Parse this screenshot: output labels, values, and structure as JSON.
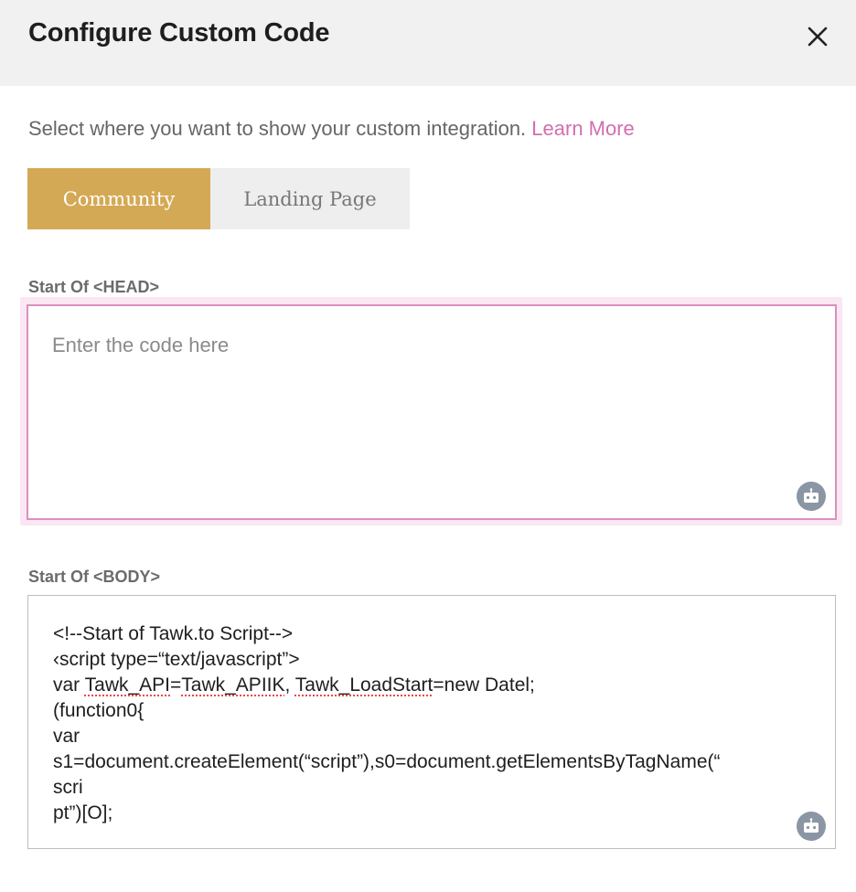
{
  "dialog": {
    "title": "Configure Custom Code",
    "close_icon": "close-icon"
  },
  "intro": {
    "text": "Select where you want to show your custom integration. ",
    "link": "Learn More"
  },
  "tabs": [
    {
      "label": "Community",
      "active": true
    },
    {
      "label": "Landing Page",
      "active": false
    }
  ],
  "head_section": {
    "label": "Start Of <HEAD>",
    "placeholder": "Enter the code here",
    "value": "",
    "assist_icon": "robot-icon"
  },
  "body_section": {
    "label": "Start Of <BODY>",
    "assist_icon": "robot-icon",
    "code_lines": [
      [
        "<!--Start of Tawk.to Script-->"
      ],
      [
        "‹script type=“text/javascript”>"
      ],
      [
        "var ",
        {
          "t": "Tawk_API",
          "u": true
        },
        "=",
        {
          "t": "Tawk_APIIK",
          "u": true
        },
        ", ",
        {
          "t": "Tawk_LoadStart",
          "u": true
        },
        "=new Datel;"
      ],
      [
        "(function0{"
      ],
      [
        "var"
      ],
      [
        "s1=document.createElement(“script”),s0=document.getElementsByTagName(“"
      ],
      [
        "scri"
      ],
      [
        "pt”)[O];"
      ]
    ]
  },
  "colors": {
    "accent": "#d4a955",
    "link": "#d16fae",
    "focus_border": "#d990bf",
    "header_bg": "#f1f1f1"
  }
}
